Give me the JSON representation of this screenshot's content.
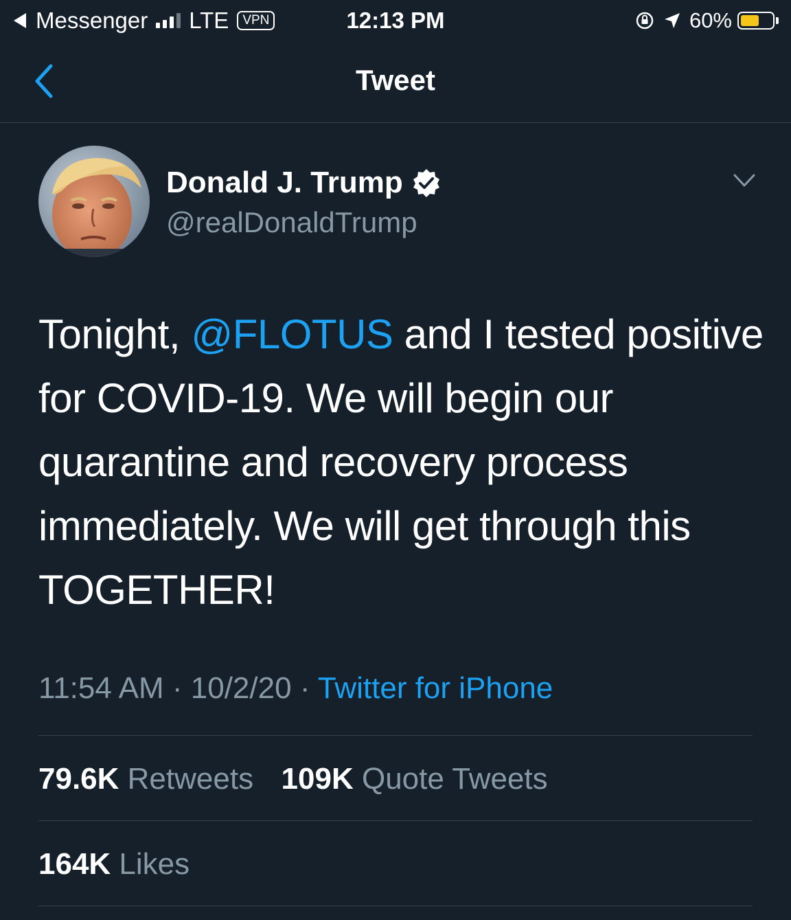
{
  "status_bar": {
    "back_app": "Messenger",
    "network": "LTE",
    "vpn": "VPN",
    "time": "12:13 PM",
    "battery_percent": "60%",
    "battery_level": 0.6,
    "battery_color": "#f5c518"
  },
  "nav": {
    "title": "Tweet",
    "back_icon": "chevron-left-icon"
  },
  "tweet": {
    "author_name": "Donald J. Trump",
    "author_handle": "@realDonaldTrump",
    "verified_icon": "verified-badge-icon",
    "more_icon": "chevron-down-icon",
    "text_before": "Tonight, ",
    "mention": "@FLOTUS",
    "text_after": " and I tested positive for COVID-19. We will begin our quarantine and recovery process immediately. We will get through this TOGETHER!",
    "time": "11:54 AM",
    "date": "10/2/20",
    "separator": "·",
    "source": "Twitter for iPhone",
    "retweets_count": "79.6K",
    "retweets_label": "Retweets",
    "quote_count": "109K",
    "quote_label": "Quote Tweets",
    "likes_count": "164K",
    "likes_label": "Likes"
  },
  "colors": {
    "background": "#15202b",
    "accent": "#1da1f2",
    "secondary_text": "#8899a6",
    "divider": "#38444d"
  }
}
